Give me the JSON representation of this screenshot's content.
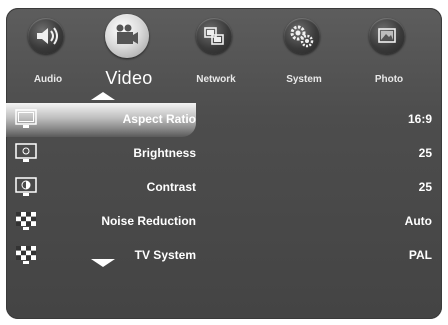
{
  "tabs": [
    {
      "label": "Audio",
      "icon": "speaker-icon"
    },
    {
      "label": "Video",
      "icon": "camera-icon"
    },
    {
      "label": "Network",
      "icon": "network-icon"
    },
    {
      "label": "System",
      "icon": "gears-icon"
    },
    {
      "label": "Photo",
      "icon": "photo-icon"
    }
  ],
  "active_tab": "Video",
  "settings": [
    {
      "label": "Aspect Ratio",
      "value": "16:9",
      "icon": "monitor-icon"
    },
    {
      "label": "Brightness",
      "value": "25",
      "icon": "monitor-icon"
    },
    {
      "label": "Contrast",
      "value": "25",
      "icon": "contrast-icon"
    },
    {
      "label": "Noise Reduction",
      "value": "Auto",
      "icon": "checker-icon"
    },
    {
      "label": "TV System",
      "value": "PAL",
      "icon": "checker-icon"
    }
  ],
  "selected_setting": "Aspect Ratio",
  "colors": {
    "panel": "#4d4d4d",
    "text": "#ffffff",
    "highlight": "#c8c8c8"
  }
}
